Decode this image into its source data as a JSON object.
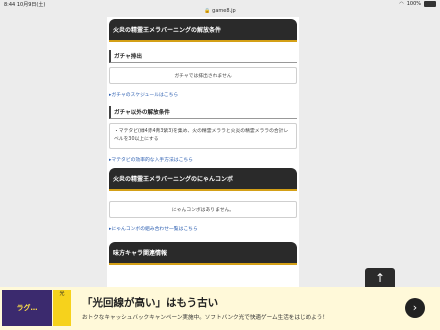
{
  "status": {
    "time": "8:44",
    "date": "10月9日(土)",
    "battery": "100%"
  },
  "url": "game8.jp",
  "sections": {
    "s1_title": "火炎の精霊王メラバーニングの解放条件",
    "gacha_title": "ガチャ排出",
    "gacha_text": "ガチャでは排出されません",
    "gacha_link": "ガチャのスケジュールはこちら",
    "other_title": "ガチャ以外の解放条件",
    "other_text": "・マテタビ(緑4赤4青3紫3)を集め、火の精霊メララと火炎の精霊メララの合計レベルを30以上にする",
    "other_link": "マテタビの効率的な入手方法はこちら",
    "s2_title": "火炎の精霊王メラバーニングのにゃんコンボ",
    "combo_text": "にゃんコンボはありません。",
    "combo_link": "にゃんコンボの組み合わせ一覧はこちら",
    "s3_title": "味方キャラ関連情報"
  },
  "scroll_top_icon": "↑",
  "ad": {
    "thumb_text": "ラグ…",
    "logo_text": "光",
    "title": "「光回線が高い」はもう古い",
    "subtitle": "おトクなキャッシュバックキャンペーン実施中。ソフトバンク光で快適ゲーム生活をはじめよう！",
    "arrow": "›"
  }
}
